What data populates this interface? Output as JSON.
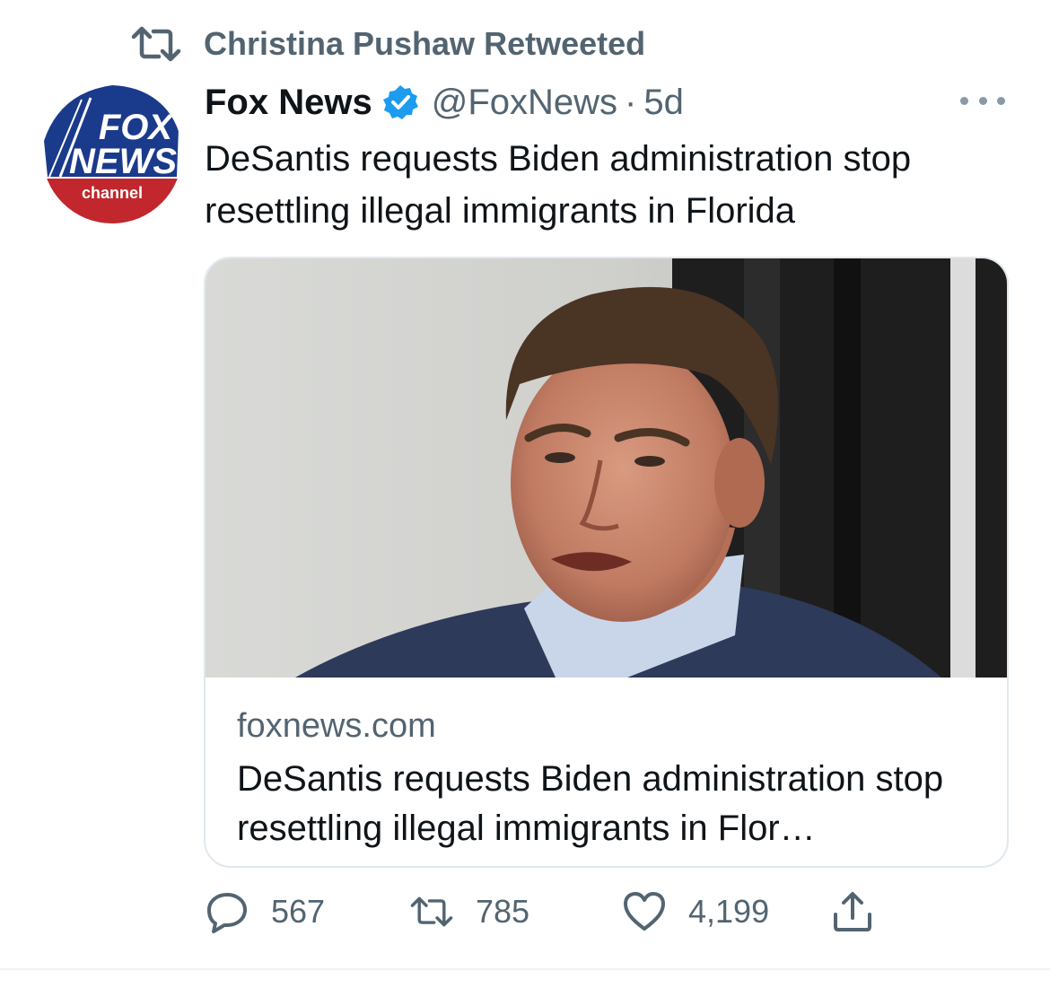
{
  "retweet_context": {
    "text": "Christina Pushaw Retweeted"
  },
  "tweet": {
    "author_name": "Fox News",
    "handle": "@FoxNews",
    "separator": "·",
    "time": "5d",
    "text": "DeSantis requests Biden administration stop resettling illegal immigrants in Florida",
    "avatar": {
      "logo_top": "FOX",
      "logo_bottom": "NEWS",
      "logo_tag": "channel"
    }
  },
  "card": {
    "domain": "foxnews.com",
    "title": "DeSantis requests Biden administration stop resettling illegal immigrants in Flor…"
  },
  "actions": {
    "replies": "567",
    "retweets": "785",
    "likes": "4,199"
  },
  "icons": {
    "retweet": "retweet-icon",
    "verified": "verified-badge-icon",
    "more": "more-icon",
    "reply": "reply-icon",
    "like": "heart-icon",
    "share": "share-icon"
  },
  "colors": {
    "verified": "#1d9bf0",
    "secondary_text": "#536471",
    "fox_blue": "#1a3a8c",
    "fox_red": "#c1272d"
  }
}
